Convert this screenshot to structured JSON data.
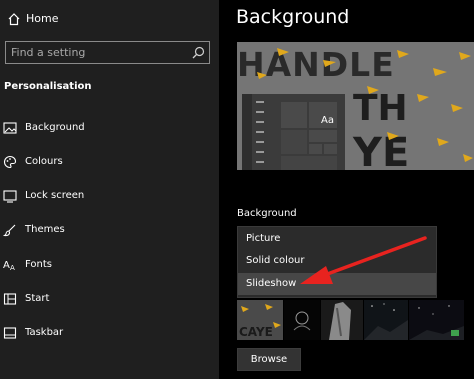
{
  "sidebar": {
    "home_label": "Home",
    "search_placeholder": "Find a setting",
    "section_title": "Personalisation",
    "items": [
      {
        "label": "Background",
        "icon": "image-icon"
      },
      {
        "label": "Colours",
        "icon": "palette-icon"
      },
      {
        "label": "Lock screen",
        "icon": "lock-screen-icon"
      },
      {
        "label": "Themes",
        "icon": "brush-icon"
      },
      {
        "label": "Fonts",
        "icon": "font-icon"
      },
      {
        "label": "Start",
        "icon": "start-grid-icon"
      },
      {
        "label": "Taskbar",
        "icon": "taskbar-icon"
      }
    ]
  },
  "main": {
    "title": "Background",
    "preview": {
      "sample_text": "Aa",
      "wallpaper_text": "HANDLE TH YE"
    },
    "background_field": {
      "label": "Background",
      "options": [
        "Picture",
        "Solid colour",
        "Slideshow"
      ],
      "selected": "Slideshow"
    },
    "browse_label": "Browse"
  },
  "colors": {
    "sidebar_bg": "#1f1f1f",
    "main_bg": "#000000",
    "accent_arrow": "#e8231f",
    "dropdown_bg": "#2b2b2b",
    "selected_option_bg": "#474747"
  }
}
